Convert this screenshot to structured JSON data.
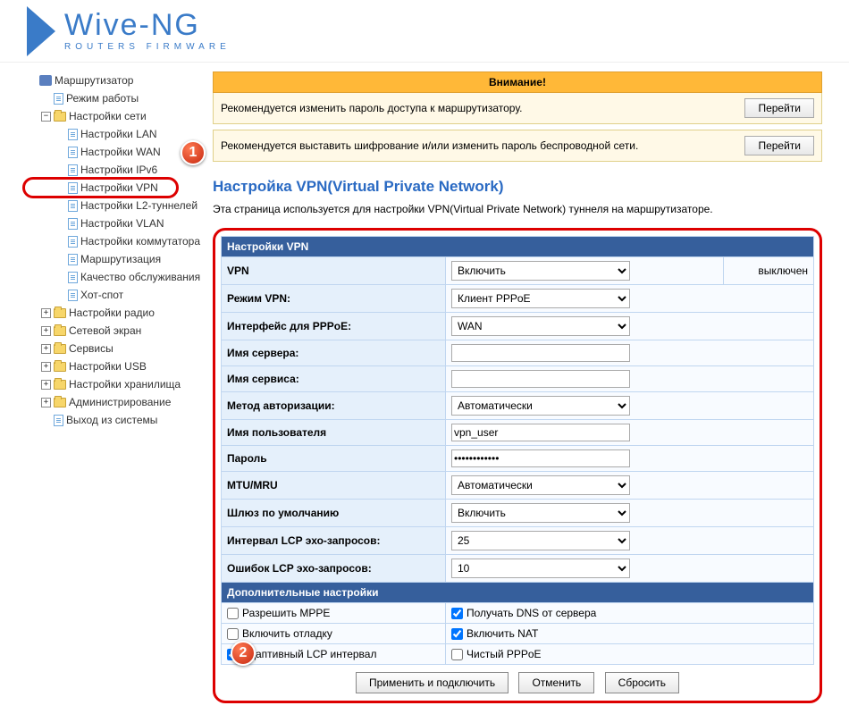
{
  "logo": {
    "name": "Wive-NG",
    "sub": "ROUTERS FIRMWARE"
  },
  "sidebar": {
    "router": "Маршрутизатор",
    "mode": "Режим работы",
    "network": "Настройки сети",
    "lan": "Настройки LAN",
    "wan": "Настройки WAN",
    "ipv6": "Настройки IPv6",
    "vpn": "Настройки VPN",
    "l2": "Настройки L2-туннелей",
    "vlan": "Настройки VLAN",
    "switch": "Настройки коммутатора",
    "routing": "Маршрутизация",
    "qos": "Качество обслуживания",
    "hotspot": "Хот-спот",
    "radio": "Настройки радио",
    "firewall": "Сетевой экран",
    "services": "Сервисы",
    "usb": "Настройки USB",
    "storage": "Настройки хранилища",
    "admin": "Администрирование",
    "logout": "Выход из системы"
  },
  "alerts": {
    "header": "Внимание!",
    "msg1": "Рекомендуется изменить пароль доступа к маршрутизатору.",
    "msg2": "Рекомендуется выставить шифрование и/или изменить пароль беспроводной сети.",
    "go": "Перейти"
  },
  "page": {
    "title": "Настройка VPN(Virtual Private Network)",
    "desc": "Эта страница используется для настройки VPN(Virtual Private Network) туннеля на маршрутизаторе."
  },
  "form": {
    "section1": "Настройки VPN",
    "vpn_label": "VPN",
    "vpn_value": "Включить",
    "vpn_status": "выключен",
    "mode_label": "Режим VPN:",
    "mode_value": "Клиент PPPoE",
    "iface_label": "Интерфейс для PPPoE:",
    "iface_value": "WAN",
    "server_label": "Имя сервера:",
    "server_value": "",
    "service_label": "Имя сервиса:",
    "service_value": "",
    "auth_label": "Метод авторизации:",
    "auth_value": "Автоматически",
    "user_label": "Имя пользователя",
    "user_value": "vpn_user",
    "pass_label": "Пароль",
    "pass_value": "••••••••••••",
    "mtu_label": "MTU/MRU",
    "mtu_value": "Автоматически",
    "gw_label": "Шлюз по умолчанию",
    "gw_value": "Включить",
    "lcp_int_label": "Интервал LCP эхо-запросов:",
    "lcp_int_value": "25",
    "lcp_err_label": "Ошибок LCP эхо-запросов:",
    "lcp_err_value": "10",
    "section2": "Дополнительные настройки",
    "chk_mppe": "Разрешить MPPE",
    "chk_dns": "Получать DNS от сервера",
    "chk_debug": "Включить отладку",
    "chk_nat": "Включить NAT",
    "chk_lcp": "Адаптивный LCP интервал",
    "chk_pure": "Чистый PPPoE"
  },
  "buttons": {
    "apply": "Применить и подключить",
    "cancel": "Отменить",
    "reset": "Сбросить"
  },
  "badges": {
    "one": "1",
    "two": "2"
  }
}
